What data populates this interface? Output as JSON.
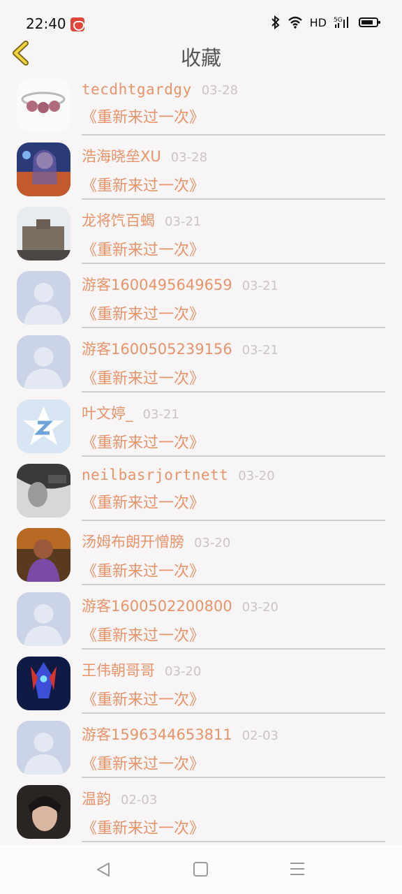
{
  "status": {
    "time": "22:40",
    "network": "HD",
    "signal": "5G",
    "icons": [
      "bluetooth-icon",
      "wifi-icon",
      "signal-icon",
      "battery-icon"
    ]
  },
  "header": {
    "title": "收藏",
    "back_icon": "chevron-left-icon"
  },
  "items": [
    {
      "name": "tecdhtgardgy",
      "date": "03-28",
      "book": "《重新来过一次》",
      "avatar": "ring"
    },
    {
      "name": "浩海晓垒XU",
      "date": "03-28",
      "book": "《重新来过一次》",
      "avatar": "anime"
    },
    {
      "name": "龙将饩百蝎",
      "date": "03-21",
      "book": "《重新来过一次》",
      "avatar": "building"
    },
    {
      "name": "游客1600495649659",
      "date": "03-21",
      "book": "《重新来过一次》",
      "avatar": "default"
    },
    {
      "name": "游客1600505239156",
      "date": "03-21",
      "book": "《重新来过一次》",
      "avatar": "default"
    },
    {
      "name": "叶文婷_",
      "date": "03-21",
      "book": "《重新来过一次》",
      "avatar": "qq"
    },
    {
      "name": "neilbasrjortnett",
      "date": "03-20",
      "book": "《重新来过一次》",
      "avatar": "bw"
    },
    {
      "name": "汤姆布朗开憎膀",
      "date": "03-20",
      "book": "《重新来过一次》",
      "avatar": "warrior"
    },
    {
      "name": "游客1600502200800",
      "date": "03-20",
      "book": "《重新来过一次》",
      "avatar": "default"
    },
    {
      "name": "王伟朝哥哥",
      "date": "03-20",
      "book": "《重新来过一次》",
      "avatar": "hero"
    },
    {
      "name": "游客1596344653811",
      "date": "02-03",
      "book": "《重新来过一次》",
      "avatar": "default"
    },
    {
      "name": "温韵",
      "date": "02-03",
      "book": "《重新来过一次》",
      "avatar": "face"
    }
  ],
  "bottom_nav": {
    "icons": [
      "back-triangle-icon",
      "home-square-icon",
      "menu-lines-icon"
    ]
  },
  "colors": {
    "accent": "#e7946a",
    "date": "#c9c4c6",
    "divider": "#cfcfd0",
    "background": "#f7f5f6"
  }
}
